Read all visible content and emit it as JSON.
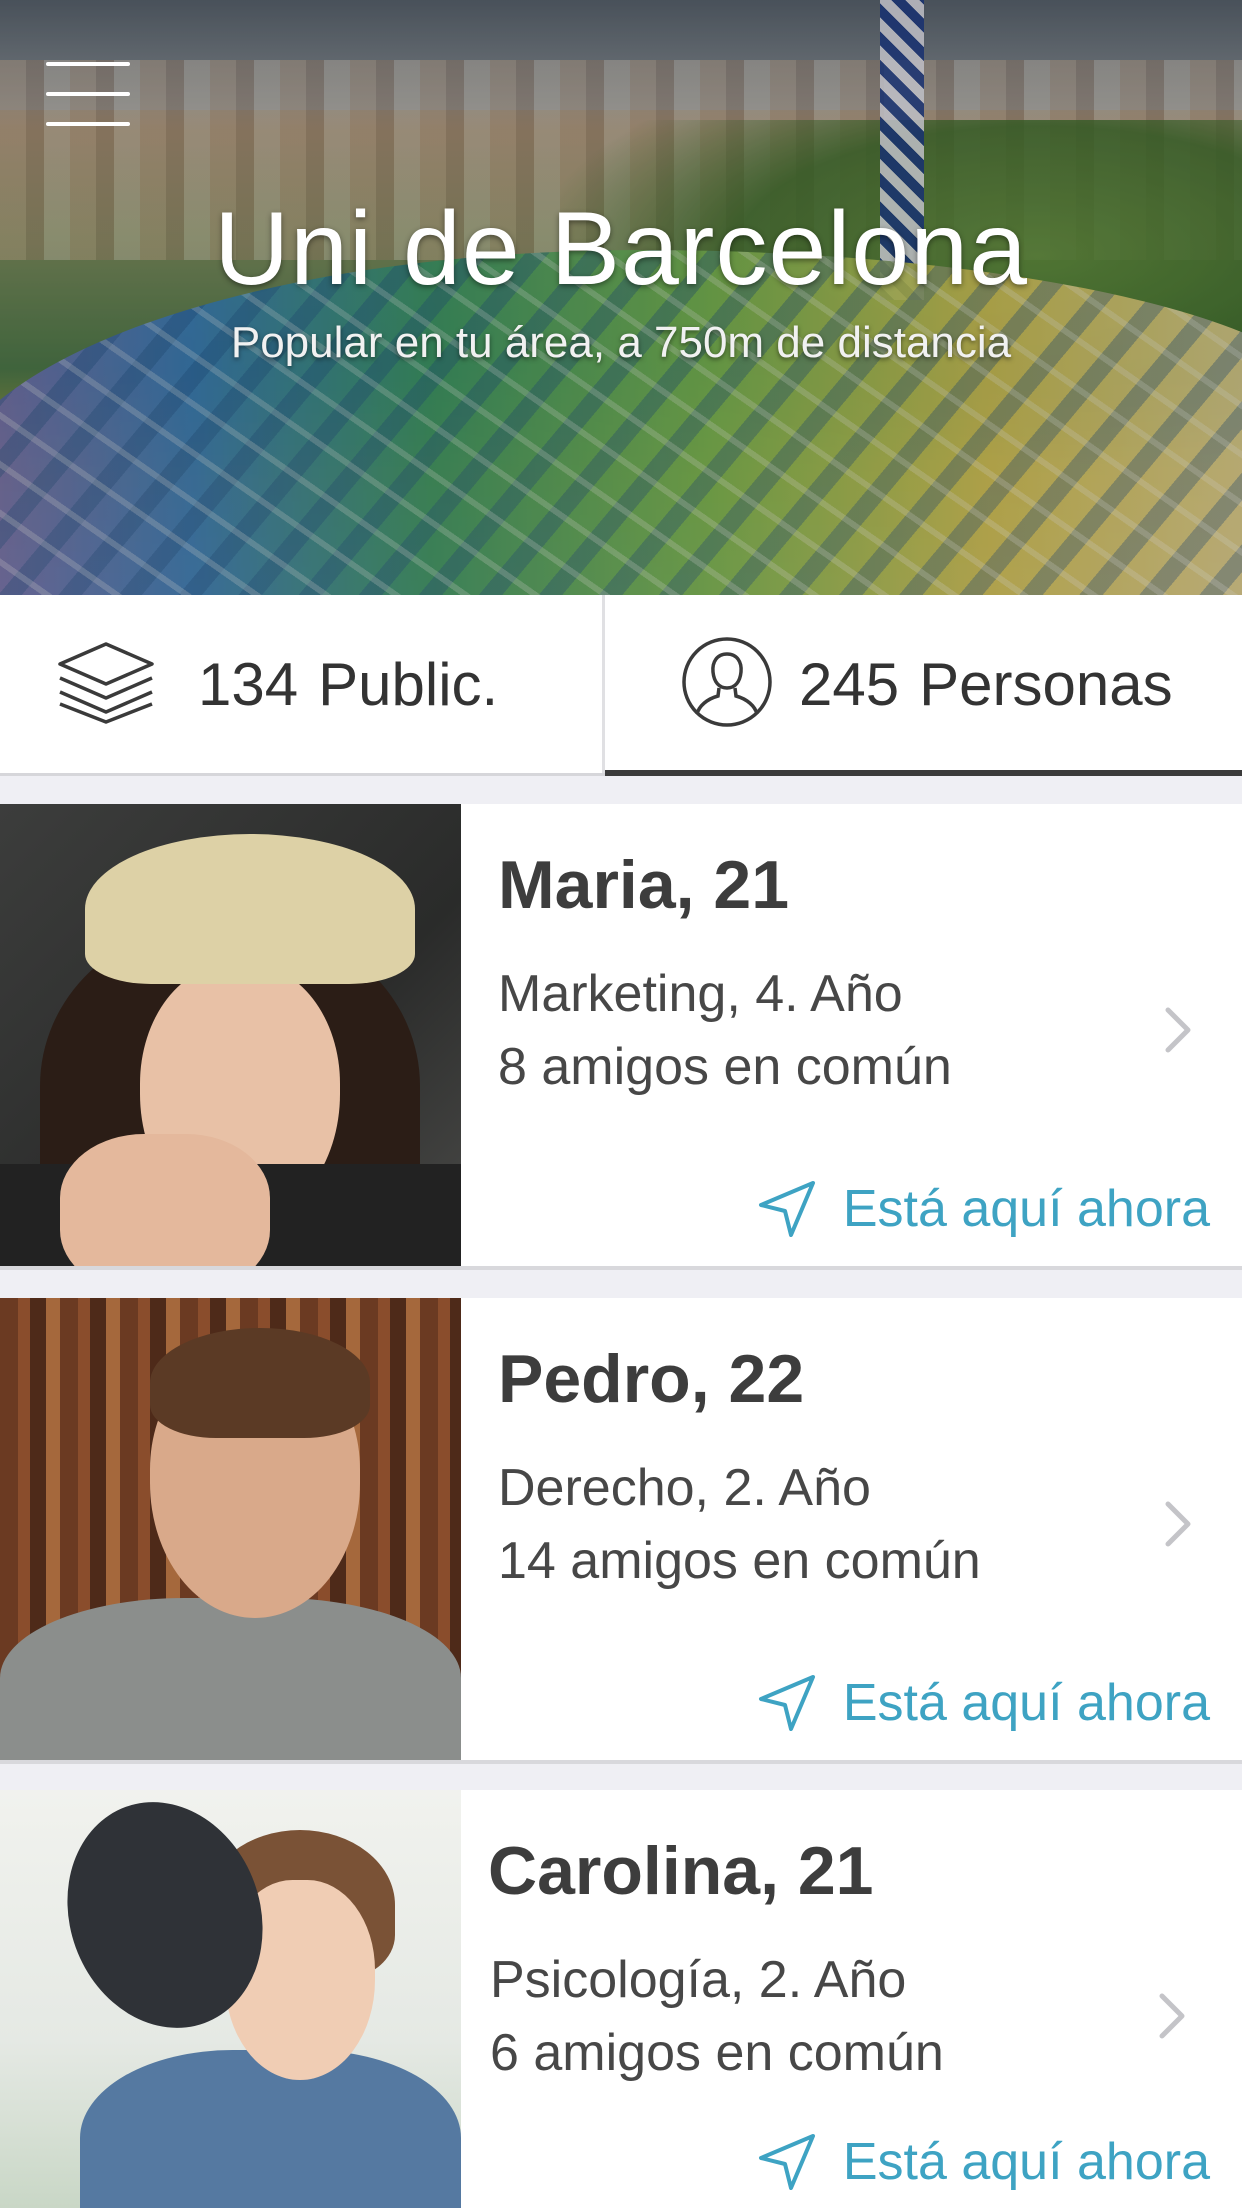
{
  "hero": {
    "title": "Uni de Barcelona",
    "subtitle": "Popular en tu área, a 750m de distancia"
  },
  "tabs": [
    {
      "count": "134",
      "label": "Public.",
      "icon": "layers-icon",
      "active": false
    },
    {
      "count": "245",
      "label": "Personas",
      "icon": "person-icon",
      "active": true
    }
  ],
  "people": [
    {
      "name": "Maria, 21",
      "study": "Marketing, 4. Año",
      "friends": "8 amigos en común",
      "status": "Está aquí ahora"
    },
    {
      "name": "Pedro, 22",
      "study": "Derecho, 2. Año",
      "friends": "14 amigos en común",
      "status": "Está aquí ahora"
    },
    {
      "name": "Carolina, 21",
      "study": "Psicología, 2. Año",
      "friends": "6 amigos en común",
      "status": "Está aquí ahora"
    }
  ],
  "colors": {
    "accent": "#3ea3c3",
    "text": "#3d3d3d",
    "background": "#efeff4"
  }
}
